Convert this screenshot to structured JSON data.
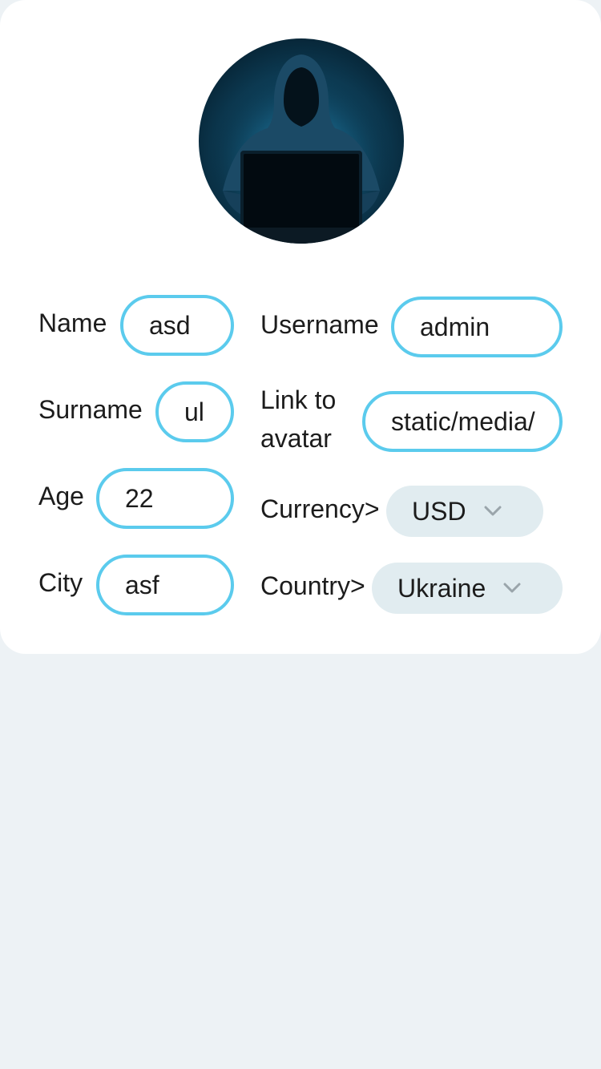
{
  "profile": {
    "name_label": "Name",
    "name_value": "asd",
    "username_label": "Username",
    "username_value": "admin",
    "surname_label": "Surname",
    "surname_value": "ul",
    "avatar_link_label": "Link to avatar",
    "avatar_link_value": "static/media/",
    "age_label": "Age",
    "age_value": "22",
    "currency_label": "Currency>",
    "currency_selected": "USD",
    "city_label": "City",
    "city_value": "asf",
    "country_label": "Country>",
    "country_selected": "Ukraine"
  },
  "colors": {
    "accent": "#5bcbed",
    "select_bg": "#e1ecf0",
    "page_bg": "#edf2f5"
  },
  "icons": {
    "avatar": "hooded-hacker-image",
    "dropdown": "chevron-down-icon"
  }
}
